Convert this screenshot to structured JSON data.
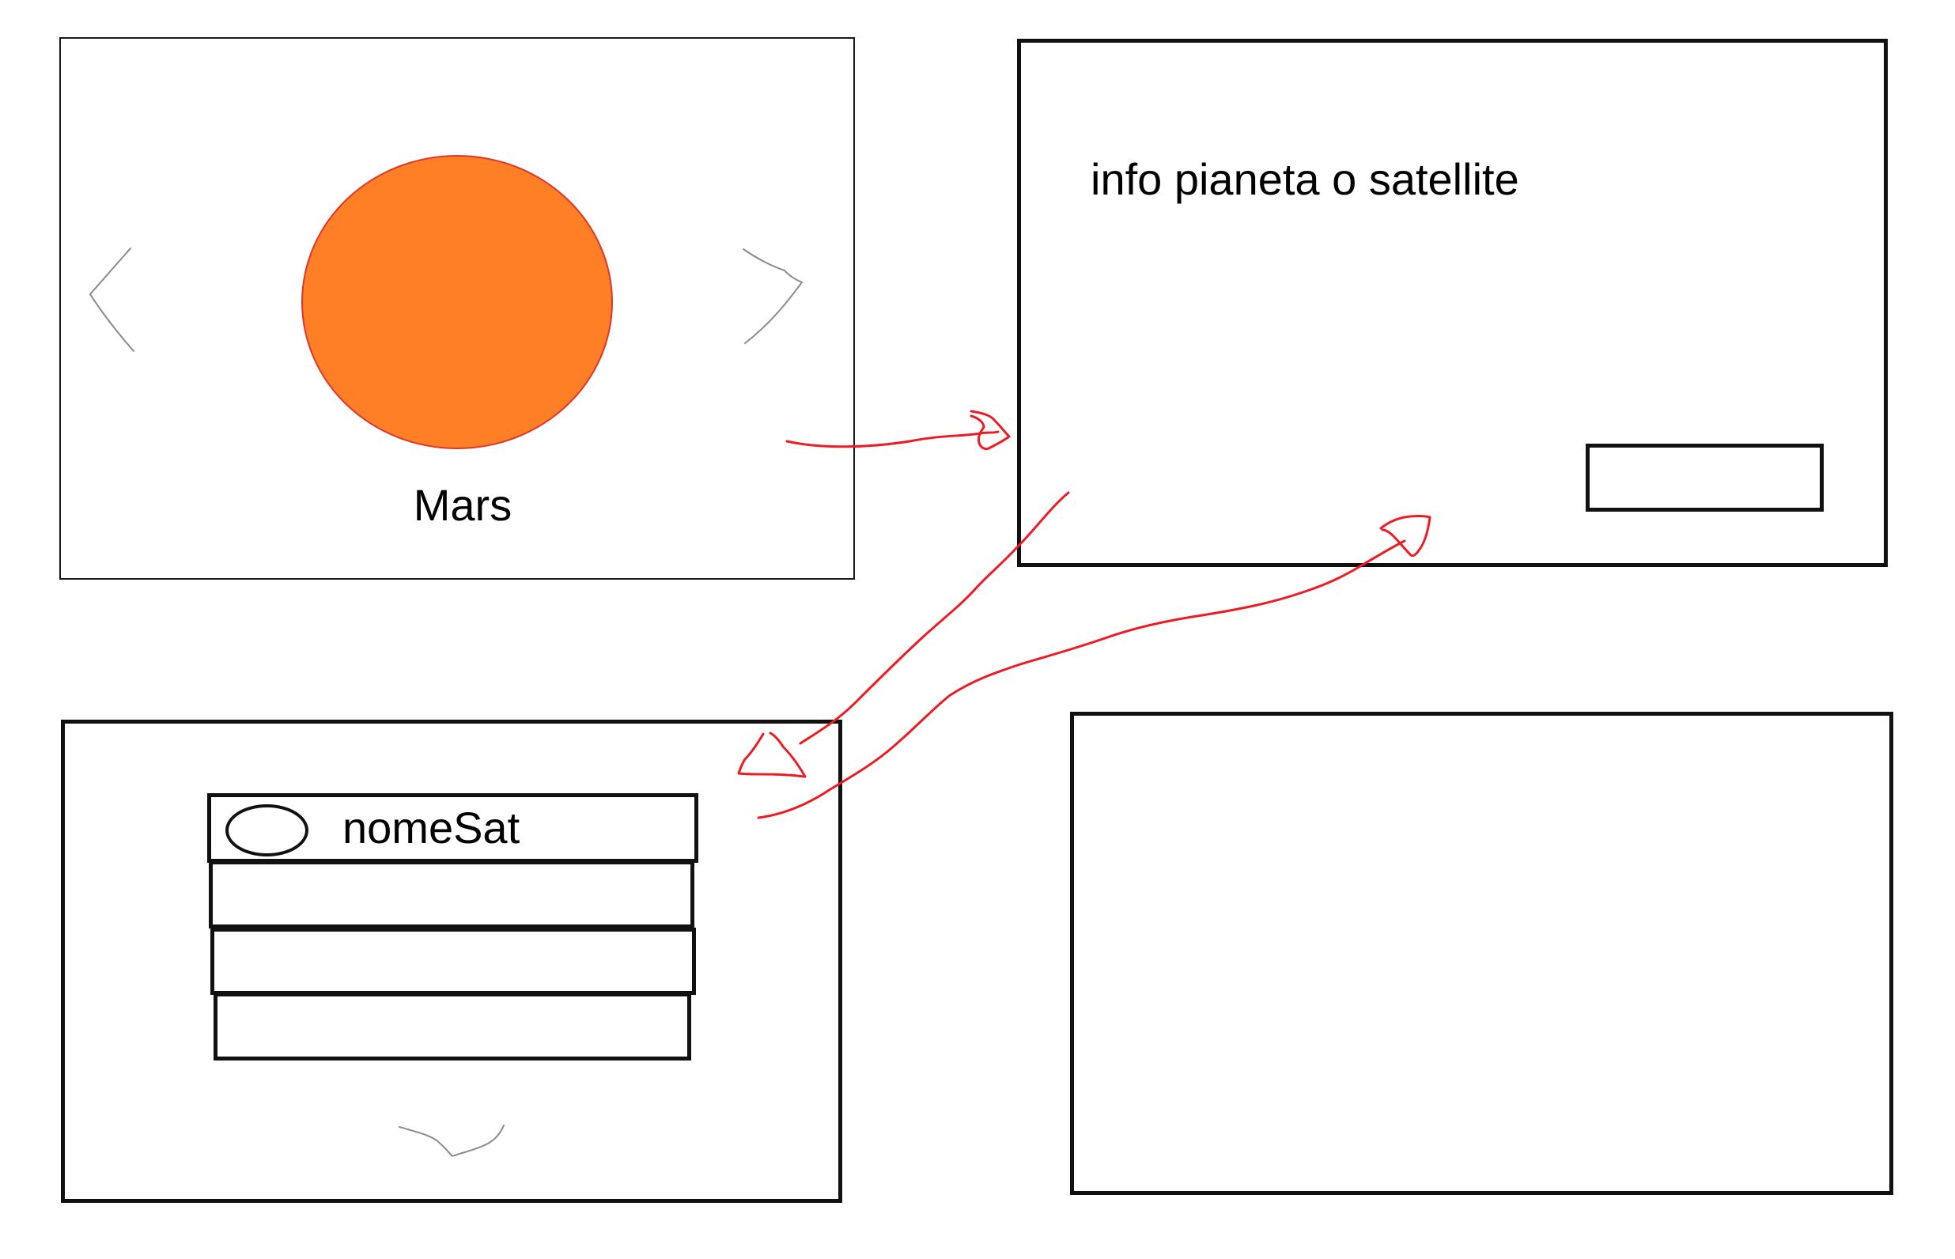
{
  "screens": {
    "planet": {
      "name": "Mars",
      "planet_color": "#ff7f27",
      "planet_outline_color": "#e0352b",
      "prev_icon": "chevron-left-icon",
      "next_icon": "chevron-right-icon"
    },
    "info": {
      "title": "info pianeta o satellite",
      "button_label": ""
    },
    "satellites": {
      "items": [
        {
          "label": "nomeSat",
          "icon": "radio-oval-icon"
        },
        {
          "label": ""
        },
        {
          "label": ""
        },
        {
          "label": ""
        }
      ],
      "more_icon": "chevron-down-icon"
    },
    "empty": {}
  },
  "connectors": [
    {
      "from": "planet-screen",
      "to": "info-screen",
      "color": "#ed1c24"
    },
    {
      "from": "info-screen",
      "to": "satellites-screen",
      "color": "#ed1c24"
    },
    {
      "from": "satellites-screen",
      "to": "info-screen",
      "color": "#ed1c24"
    }
  ]
}
